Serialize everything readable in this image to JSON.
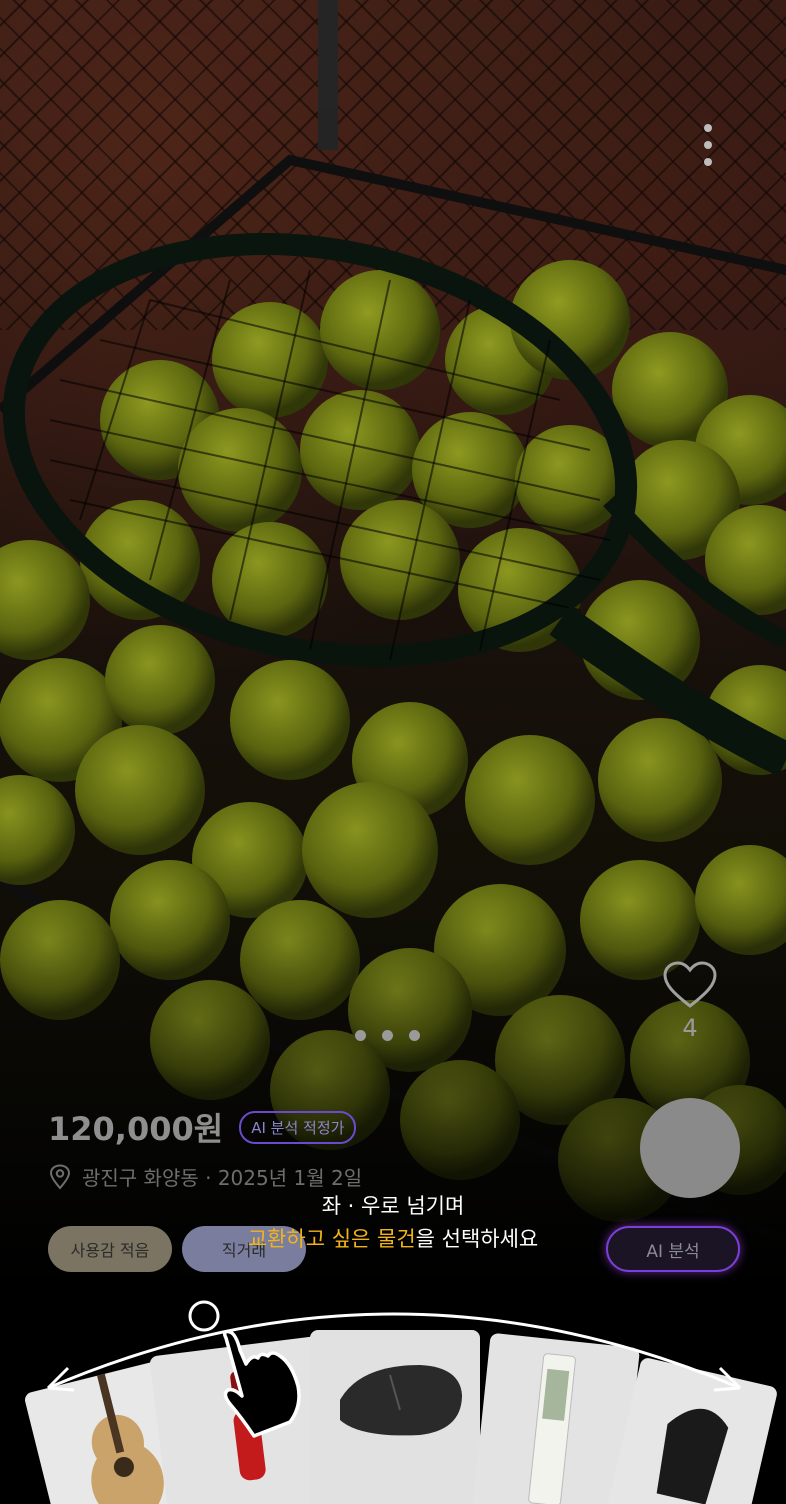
{
  "listing": {
    "price": "120,000원",
    "ai_badge": "AI 분석 적정가",
    "location": "광진구 화양동 · 2025년 1월 2일",
    "tags": [
      "사용감 적음",
      "직거래"
    ],
    "like_count": "4",
    "ai_button": "AI 분석"
  },
  "gallery": {
    "page_count": 3,
    "current_page": 1
  },
  "guide": {
    "line1": "좌 · 우로 넘기며",
    "line2_highlight": "교환하고 싶은 물건",
    "line2_rest": "을 선택하세요"
  },
  "cards": [
    {
      "item": "guitar-icon"
    },
    {
      "item": "red-stick-icon"
    },
    {
      "item": "mouse-icon"
    },
    {
      "item": "tube-icon"
    },
    {
      "item": "umbrella-icon"
    }
  ],
  "colors": {
    "highlight": "#f2b418",
    "ai_border": "#7a3fd8",
    "tennis_ball": "#8a9a1c"
  }
}
